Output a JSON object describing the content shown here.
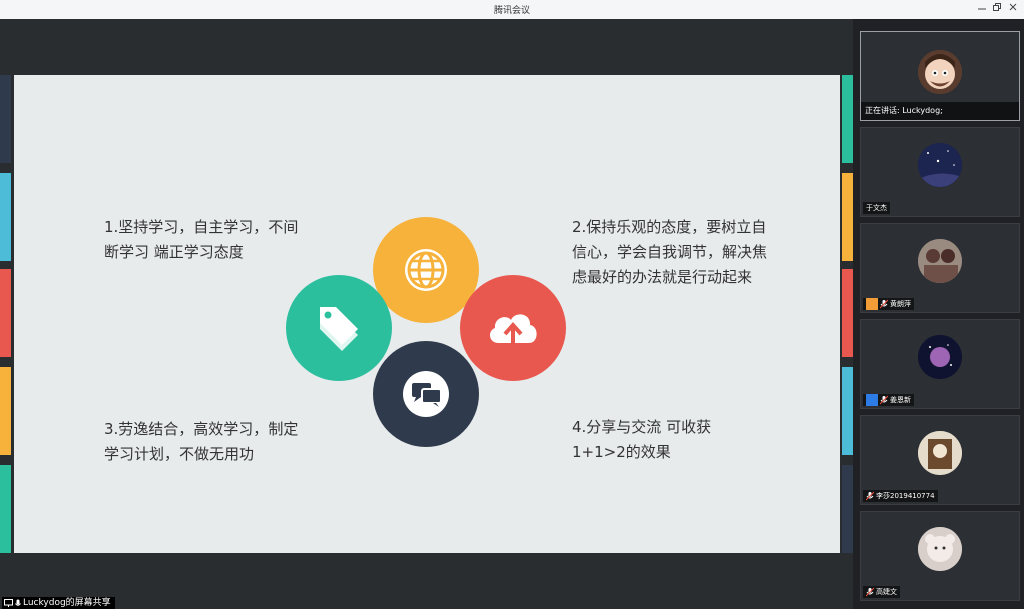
{
  "window": {
    "title": "腾讯会议"
  },
  "slide": {
    "points": [
      {
        "text": "1.坚持学习，自主学习，不间断学习  端正学习态度"
      },
      {
        "text": "2.保持乐观的态度，要树立自信心，学会自我调节，解决焦虑最好的办法就是行动起来"
      },
      {
        "text": "3.劳逸结合，高效学习，制定学习计划，不做无用功"
      },
      {
        "text": "4.分享与交流  可收获1+1>2的效果"
      }
    ],
    "colors": {
      "yellow": "#f6b23a",
      "teal": "#2bbf9e",
      "red": "#e8584f",
      "navy": "#2f3b4d",
      "blue": "#4cbcd8"
    },
    "icons": [
      "globe-icon",
      "tag-icon",
      "cloud-upload-icon",
      "chat-icon"
    ]
  },
  "participants": {
    "speaking_label": "正在讲话: Luckydog;",
    "list": [
      {
        "name": "",
        "active": true
      },
      {
        "name": "于文杰"
      },
      {
        "name": "黄朗萍"
      },
      {
        "name": "姜恩新"
      },
      {
        "name": "李莎2019410774"
      },
      {
        "name": "高婕文"
      }
    ]
  },
  "share": {
    "label": "Luckydog的屏幕共享"
  }
}
